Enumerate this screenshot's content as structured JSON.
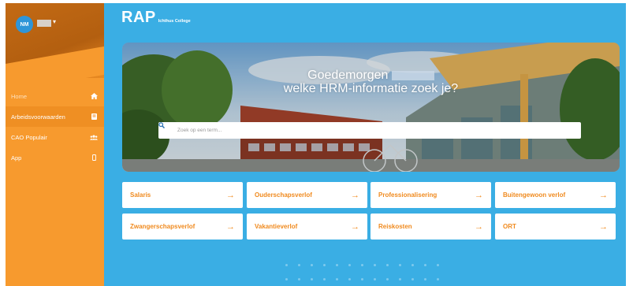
{
  "sidebar": {
    "user_initials": "NM",
    "items": [
      {
        "label": "Home",
        "icon": "home-icon"
      },
      {
        "label": "Arbeidsvoorwaarden",
        "icon": "book-icon"
      },
      {
        "label": "CAO Populair",
        "icon": "users-icon"
      },
      {
        "label": "App",
        "icon": "mobile-icon"
      }
    ]
  },
  "header": {
    "logo": "RAP",
    "organization": "Ichthus College"
  },
  "hero": {
    "greeting_line1": "Goedemorgen",
    "greeting_line2": "welke HRM-informatie zoek je?",
    "search_placeholder": "Zoek op een term..."
  },
  "tiles": [
    {
      "label": "Salaris"
    },
    {
      "label": "Ouderschapsverlof"
    },
    {
      "label": "Professionalisering"
    },
    {
      "label": "Buitengewoon verlof"
    },
    {
      "label": "Zwangerschapsverlof"
    },
    {
      "label": "Vakantieverlof"
    },
    {
      "label": "Reiskosten"
    },
    {
      "label": "ORT"
    }
  ],
  "colors": {
    "sidebar": "#f79a2e",
    "main_bg": "#3aaee4",
    "accent": "#f08a1e",
    "avatar": "#2e95d8"
  }
}
